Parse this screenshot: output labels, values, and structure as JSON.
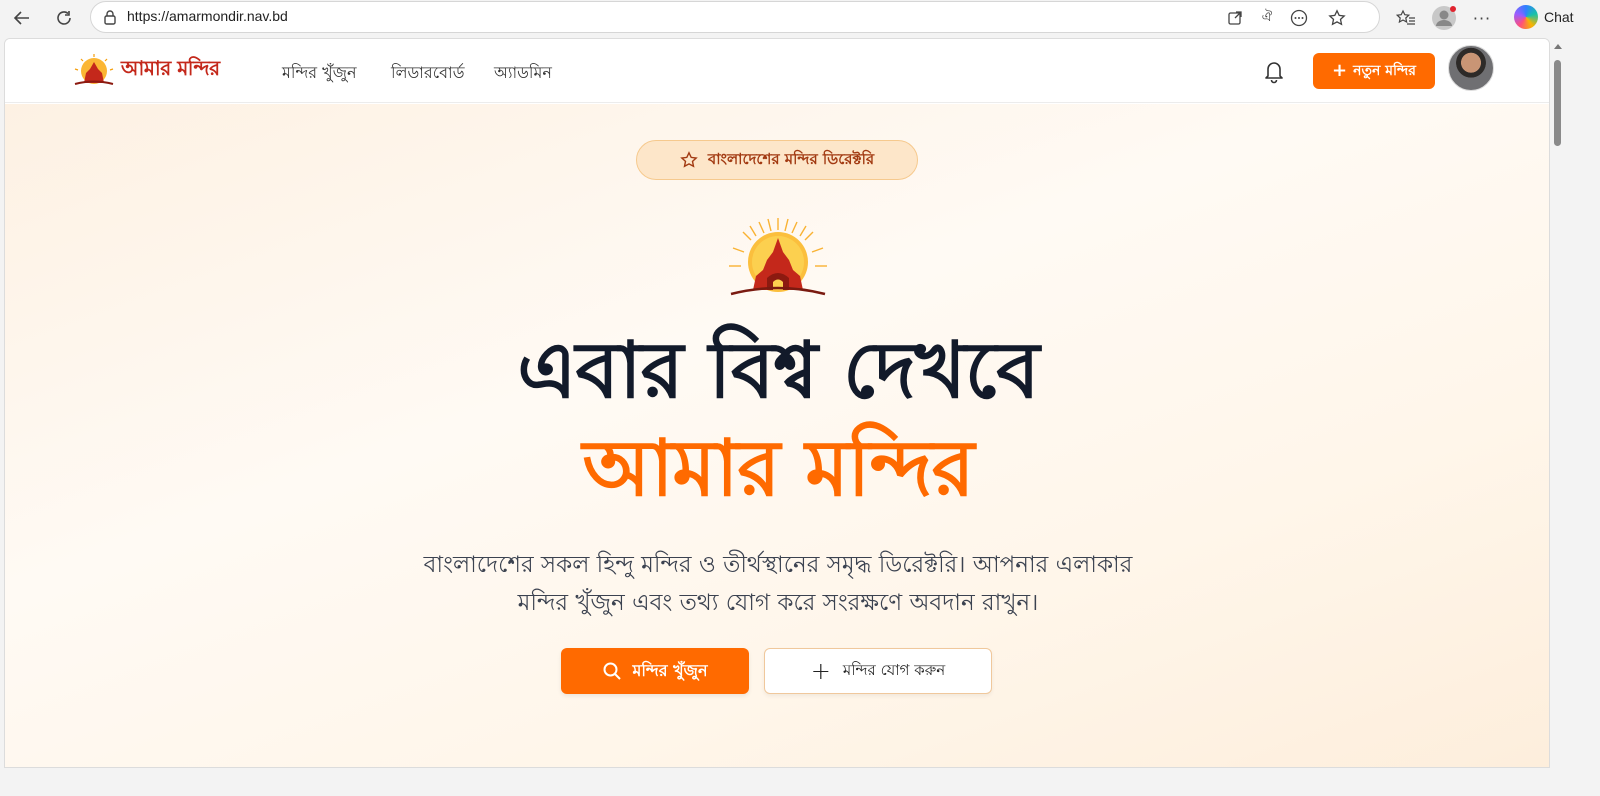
{
  "browser": {
    "url": "https://amarmondir.nav.bd",
    "chat_label": "Chat"
  },
  "header": {
    "logo_text": "আমার মন্দির",
    "nav": [
      "মন্দির খুঁজুন",
      "লিডারবোর্ড",
      "অ্যাডমিন"
    ],
    "new_button_label": "নতুন মন্দির"
  },
  "hero": {
    "badge": "বাংলাদেশের মন্দির ডিরেক্টরি",
    "title_line1": "এবার বিশ্ব দেখবে",
    "title_line2": "আমার মন্দির",
    "description_line1": "বাংলাদেশের সকল হিন্দু মন্দির ও তীর্থস্থানের সমৃদ্ধ ডিরেক্টরি। আপনার এলাকার",
    "description_line2": "মন্দির খুঁজুন এবং তথ্য যোগ করে সংরক্ষণে অবদান রাখুন।",
    "primary_button": "মন্দির খুঁজুন",
    "secondary_button": "মন্দির যোগ করুন"
  },
  "colors": {
    "accent": "#ff6a00",
    "logo_red": "#c4281b",
    "title_dark": "#121a2a"
  },
  "icons": [
    "back-icon",
    "refresh-icon",
    "lock-icon",
    "open-app-icon",
    "translate-icon",
    "extensions-icon",
    "favorite-star-icon",
    "favorites-list-icon",
    "profile-icon",
    "more-icon",
    "copilot-icon",
    "bell-icon",
    "plus-icon",
    "star-outline-icon",
    "search-icon",
    "temple-sun-icon"
  ]
}
